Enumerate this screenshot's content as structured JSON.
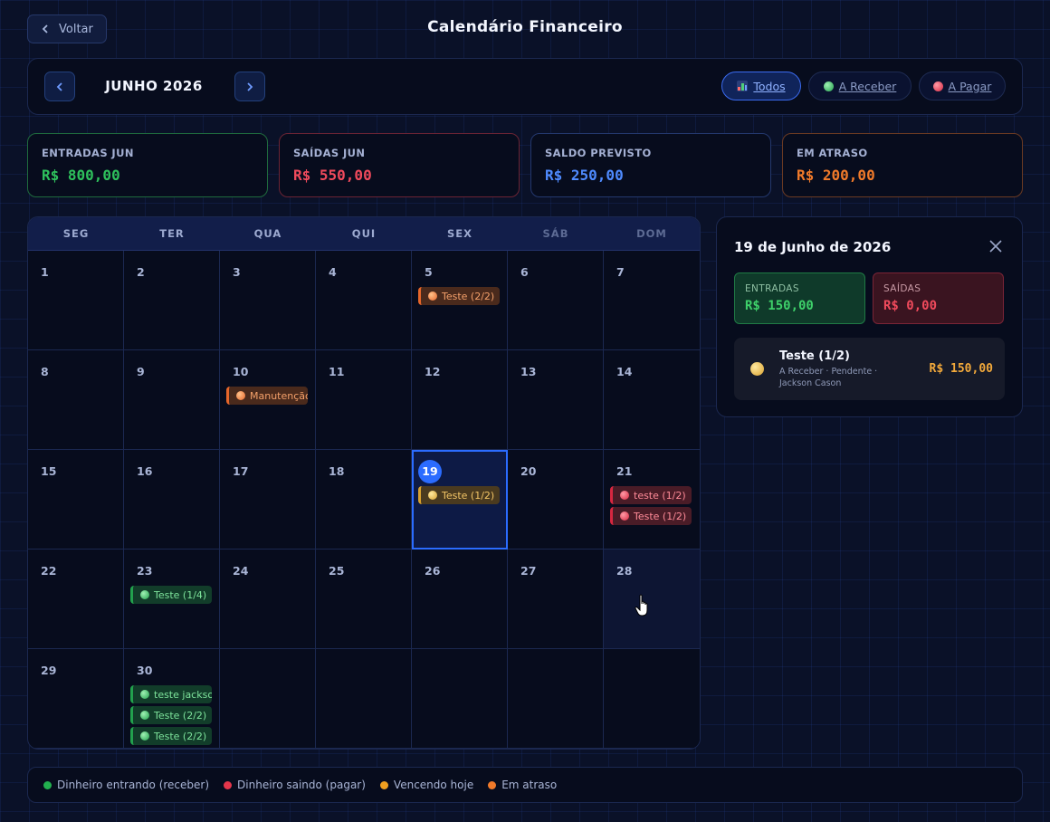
{
  "header": {
    "back_label": "Voltar",
    "title": "Calendário Financeiro"
  },
  "toolbar": {
    "month": "JUNHO 2026",
    "filters": [
      {
        "label": "Todos",
        "icon": "bar-chart-icon",
        "active": true
      },
      {
        "label": "A Receber",
        "icon": "green-dot-icon",
        "active": false
      },
      {
        "label": "A Pagar",
        "icon": "red-dot-icon",
        "active": false
      }
    ]
  },
  "stats": [
    {
      "label": "ENTRADAS JUN",
      "value": "R$ 800,00",
      "color": "#2ec05c",
      "border": "#1f6b3e"
    },
    {
      "label": "SAÍDAS JUN",
      "value": "R$ 550,00",
      "color": "#f04a5c",
      "border": "#6b2434"
    },
    {
      "label": "SALDO PREVISTO",
      "value": "R$ 250,00",
      "color": "#4f8bff",
      "border": "#24386e"
    },
    {
      "label": "EM ATRASO",
      "value": "R$ 200,00",
      "color": "#f07a2a",
      "border": "#6b3a22"
    }
  ],
  "calendar": {
    "weekdays": [
      "SEG",
      "TER",
      "QUA",
      "QUI",
      "SEX",
      "SÁB",
      "DOM"
    ],
    "days": [
      {
        "day": "1",
        "events": []
      },
      {
        "day": "2",
        "events": []
      },
      {
        "day": "3",
        "events": []
      },
      {
        "day": "4",
        "events": []
      },
      {
        "day": "5",
        "events": [
          {
            "label": "Teste (2/2)",
            "type": "orange"
          }
        ]
      },
      {
        "day": "6",
        "events": []
      },
      {
        "day": "7",
        "events": []
      },
      {
        "day": "8",
        "events": []
      },
      {
        "day": "9",
        "events": []
      },
      {
        "day": "10",
        "events": [
          {
            "label": "Manutenção",
            "type": "orange"
          }
        ]
      },
      {
        "day": "11",
        "events": []
      },
      {
        "day": "12",
        "events": []
      },
      {
        "day": "13",
        "events": []
      },
      {
        "day": "14",
        "events": []
      },
      {
        "day": "15",
        "events": []
      },
      {
        "day": "16",
        "events": []
      },
      {
        "day": "17",
        "events": []
      },
      {
        "day": "18",
        "events": []
      },
      {
        "day": "19",
        "today": true,
        "events": [
          {
            "label": "Teste (1/2)",
            "type": "yellow"
          }
        ]
      },
      {
        "day": "20",
        "events": []
      },
      {
        "day": "21",
        "events": [
          {
            "label": "teste (1/2)",
            "type": "red"
          },
          {
            "label": "Teste (1/2)",
            "type": "red"
          }
        ]
      },
      {
        "day": "22",
        "events": []
      },
      {
        "day": "23",
        "events": [
          {
            "label": "Teste (1/4)",
            "type": "green"
          }
        ]
      },
      {
        "day": "24",
        "events": []
      },
      {
        "day": "25",
        "events": []
      },
      {
        "day": "26",
        "events": []
      },
      {
        "day": "27",
        "events": []
      },
      {
        "day": "28",
        "hover": true,
        "events": []
      },
      {
        "day": "29",
        "events": []
      },
      {
        "day": "30",
        "events": [
          {
            "label": "teste jackson",
            "type": "green"
          },
          {
            "label": "Teste (2/2)",
            "type": "green"
          },
          {
            "label": "Teste (2/2)",
            "type": "green"
          }
        ]
      },
      {
        "day": "",
        "events": []
      },
      {
        "day": "",
        "events": []
      },
      {
        "day": "",
        "events": []
      },
      {
        "day": "",
        "events": []
      },
      {
        "day": "",
        "events": []
      }
    ]
  },
  "detail": {
    "title": "19 de Junho de 2026",
    "entradas_label": "ENTRADAS",
    "entradas_value": "R$ 150,00",
    "saidas_label": "SAÍDAS",
    "saidas_value": "R$ 0,00",
    "item": {
      "title": "Teste (1/2)",
      "subtitle": "A Receber · Pendente · Jackson Cason",
      "amount": "R$ 150,00"
    }
  },
  "legend": [
    {
      "label": "Dinheiro entrando (receber)",
      "color": "#22b04f"
    },
    {
      "label": "Dinheiro saindo (pagar)",
      "color": "#e5364b"
    },
    {
      "label": "Vencendo hoje",
      "color": "#f0a020"
    },
    {
      "label": "Em atraso",
      "color": "#f07a2a"
    }
  ]
}
